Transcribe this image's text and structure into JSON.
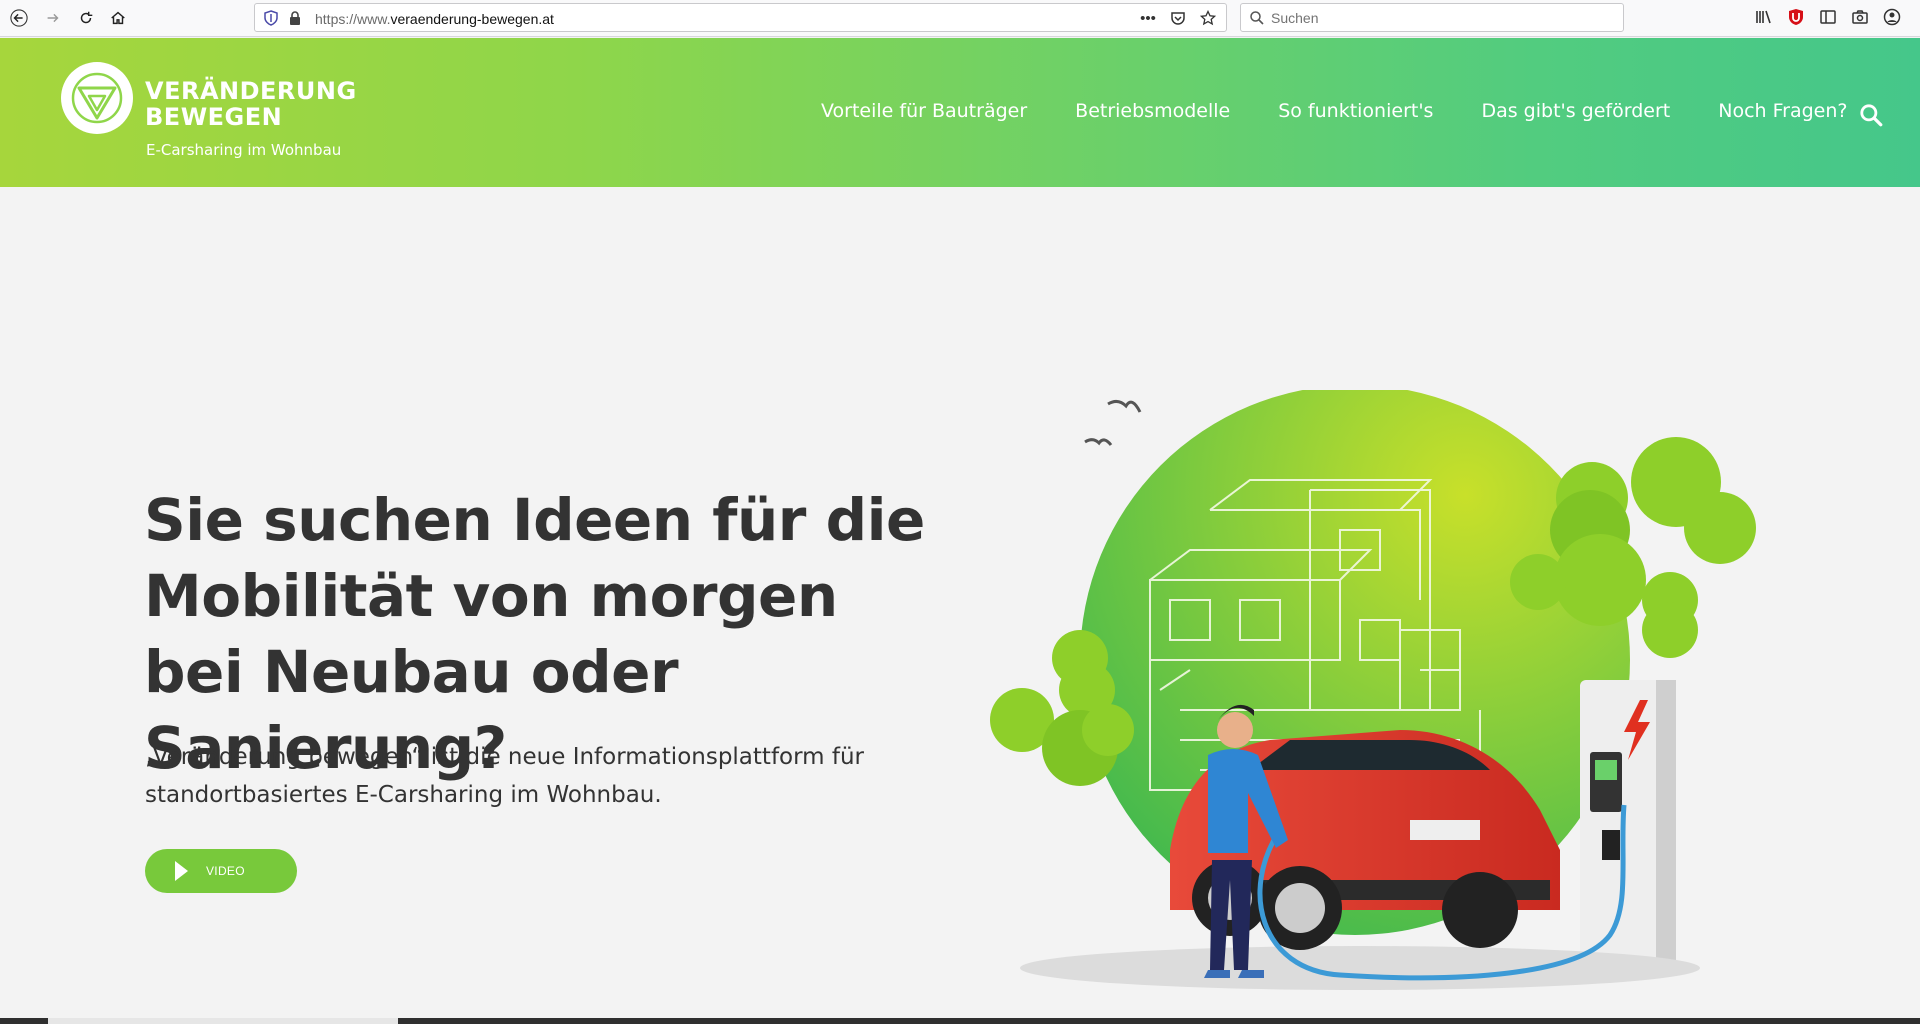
{
  "browser": {
    "url_prefix": "https://www.",
    "url_host": "veraenderung-bewegen.at",
    "search_placeholder": "Suchen",
    "icons": [
      "back-icon",
      "forward-icon",
      "reload-icon",
      "home-icon",
      "shield-icon",
      "lock-icon",
      "more-icon",
      "pocket-icon",
      "star-icon",
      "search-icon",
      "library-icon",
      "ublock-icon",
      "sidebar-icon",
      "screenshot-icon",
      "account-icon"
    ]
  },
  "header": {
    "logo_line1": "VERÄNDERUNG",
    "logo_line2": "BEWEGEN",
    "logo_subtitle": "E-Carsharing im Wohnbau",
    "nav": [
      {
        "label": "Vorteile für Bauträger"
      },
      {
        "label": "Betriebsmodelle"
      },
      {
        "label": "So funktioniert's"
      },
      {
        "label": "Das gibt's gefördert"
      },
      {
        "label": "Noch Fragen?"
      }
    ],
    "colors": {
      "gradient_start": "#a6d63c",
      "gradient_end": "#45c78a"
    }
  },
  "hero": {
    "title": "Sie suchen Ideen für die Mobilität von morgen bei Neubau oder Sanierung?",
    "text": "„Veränderung bewegen“ ist die neue Informationsplattform für standortbasiertes E-Carsharing im Wohnbau.",
    "video_label": "VIDEO",
    "accent": "#78c93b"
  }
}
